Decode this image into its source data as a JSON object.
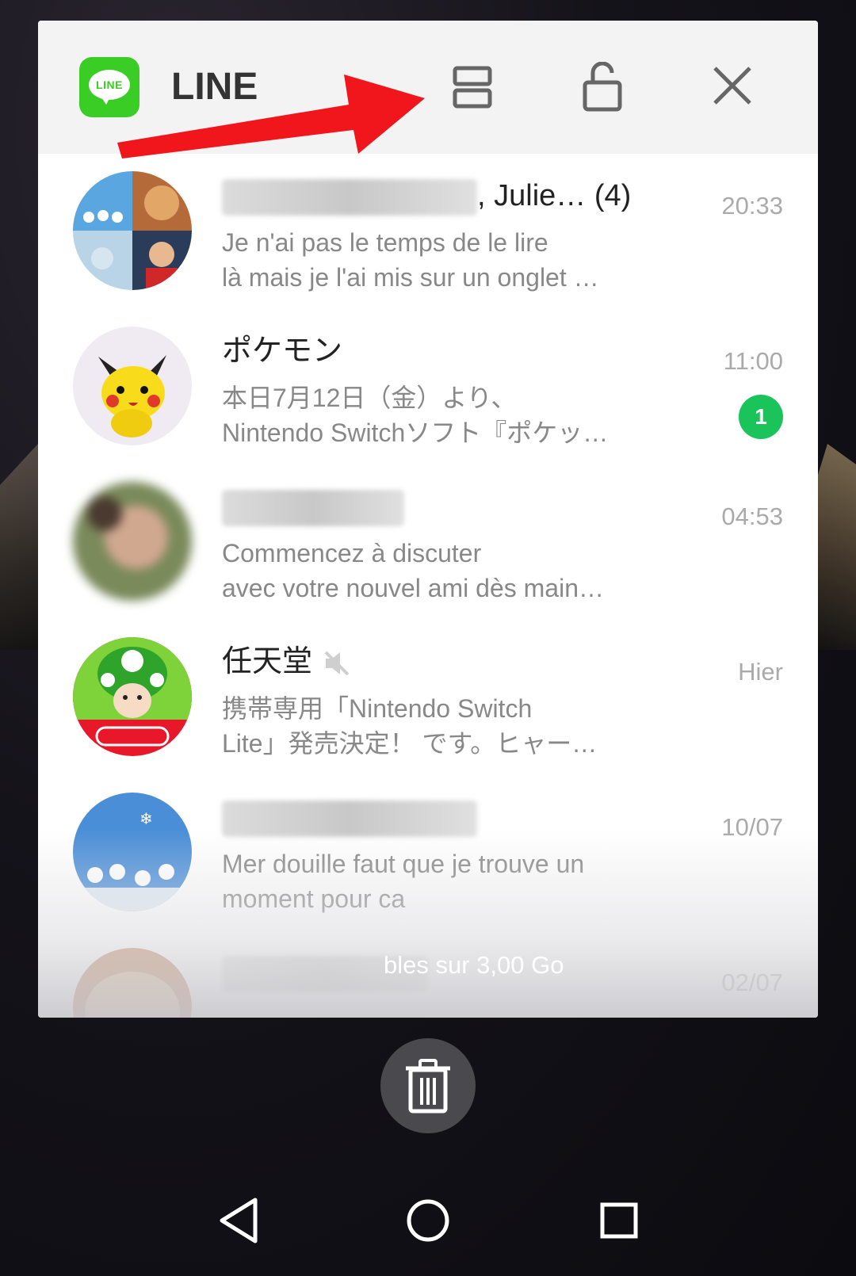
{
  "app": {
    "name": "LINE",
    "logo_text": "LINE"
  },
  "header": {
    "icons": [
      "split-screen-icon",
      "unlock-icon",
      "close-icon"
    ]
  },
  "chats": [
    {
      "name_visible": ", Julie…",
      "count": "(4)",
      "message_line1": "Je n'ai pas le temps de le lire",
      "message_line2": "là mais je l'ai mis sur un onglet …",
      "time": "20:33"
    },
    {
      "name": "ポケモン",
      "message_line1": "本日7月12日（金）より、",
      "message_line2": "Nintendo Switchソフト『ポケッ…",
      "time": "11:00",
      "unread": "1"
    },
    {
      "message_line1": "Commencez à discuter",
      "message_line2": "avec votre nouvel ami dès main…",
      "time": "04:53"
    },
    {
      "name": "任天堂",
      "message_line1": "携帯専用「Nintendo Switch",
      "message_line2": "Lite」発売決定！ です。ヒャー…",
      "time": "Hier"
    },
    {
      "message_line1": "Mer douille faut que je trouve un",
      "message_line2": "moment pour ca",
      "time": "10/07"
    },
    {
      "time": "02/07"
    }
  ],
  "storage_text": "bles sur 3,00 Go",
  "colors": {
    "line_green": "#3acd26",
    "badge_green": "#1bc45a",
    "arrow_red": "#f0161b"
  }
}
